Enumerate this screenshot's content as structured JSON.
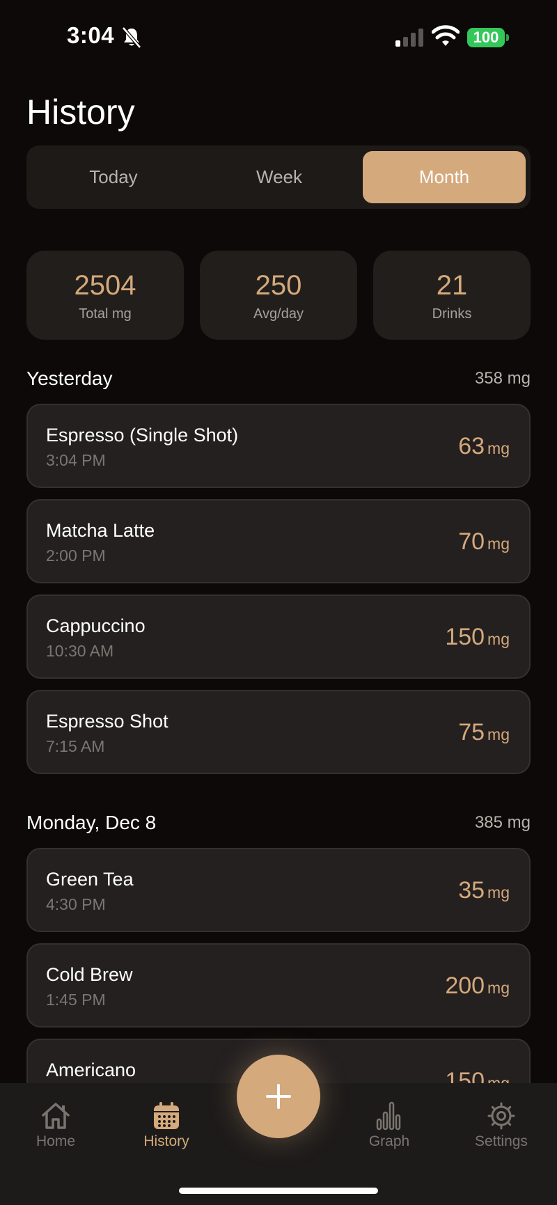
{
  "status_bar": {
    "time": "3:04",
    "battery": "100"
  },
  "title": "History",
  "segments": [
    {
      "label": "Today",
      "selected": false
    },
    {
      "label": "Week",
      "selected": false
    },
    {
      "label": "Month",
      "selected": true
    }
  ],
  "stats": [
    {
      "value": "2504",
      "label": "Total mg"
    },
    {
      "value": "250",
      "label": "Avg/day"
    },
    {
      "value": "21",
      "label": "Drinks"
    }
  ],
  "sections": [
    {
      "title": "Yesterday",
      "total": "358 mg",
      "items": [
        {
          "name": "Espresso (Single Shot)",
          "time": "3:04 PM",
          "amount": "63",
          "unit": "mg"
        },
        {
          "name": "Matcha Latte",
          "time": "2:00 PM",
          "amount": "70",
          "unit": "mg"
        },
        {
          "name": "Cappuccino",
          "time": "10:30 AM",
          "amount": "150",
          "unit": "mg"
        },
        {
          "name": "Espresso Shot",
          "time": "7:15 AM",
          "amount": "75",
          "unit": "mg"
        }
      ]
    },
    {
      "title": "Monday, Dec 8",
      "total": "385 mg",
      "items": [
        {
          "name": "Green Tea",
          "time": "4:30 PM",
          "amount": "35",
          "unit": "mg"
        },
        {
          "name": "Cold Brew",
          "time": "1:45 PM",
          "amount": "200",
          "unit": "mg"
        },
        {
          "name": "Americano",
          "time": "",
          "amount": "150",
          "unit": "mg"
        }
      ]
    }
  ],
  "tabs": [
    {
      "label": "Home",
      "icon": "home-icon",
      "active": false
    },
    {
      "label": "History",
      "icon": "calendar-icon",
      "active": true
    },
    {
      "label": "Graph",
      "icon": "bar-chart-icon",
      "active": false
    },
    {
      "label": "Settings",
      "icon": "gear-icon",
      "active": false
    }
  ],
  "colors": {
    "accent": "#d4a97c",
    "background": "#0c0908",
    "card": "#242020",
    "battery": "#34c759"
  }
}
